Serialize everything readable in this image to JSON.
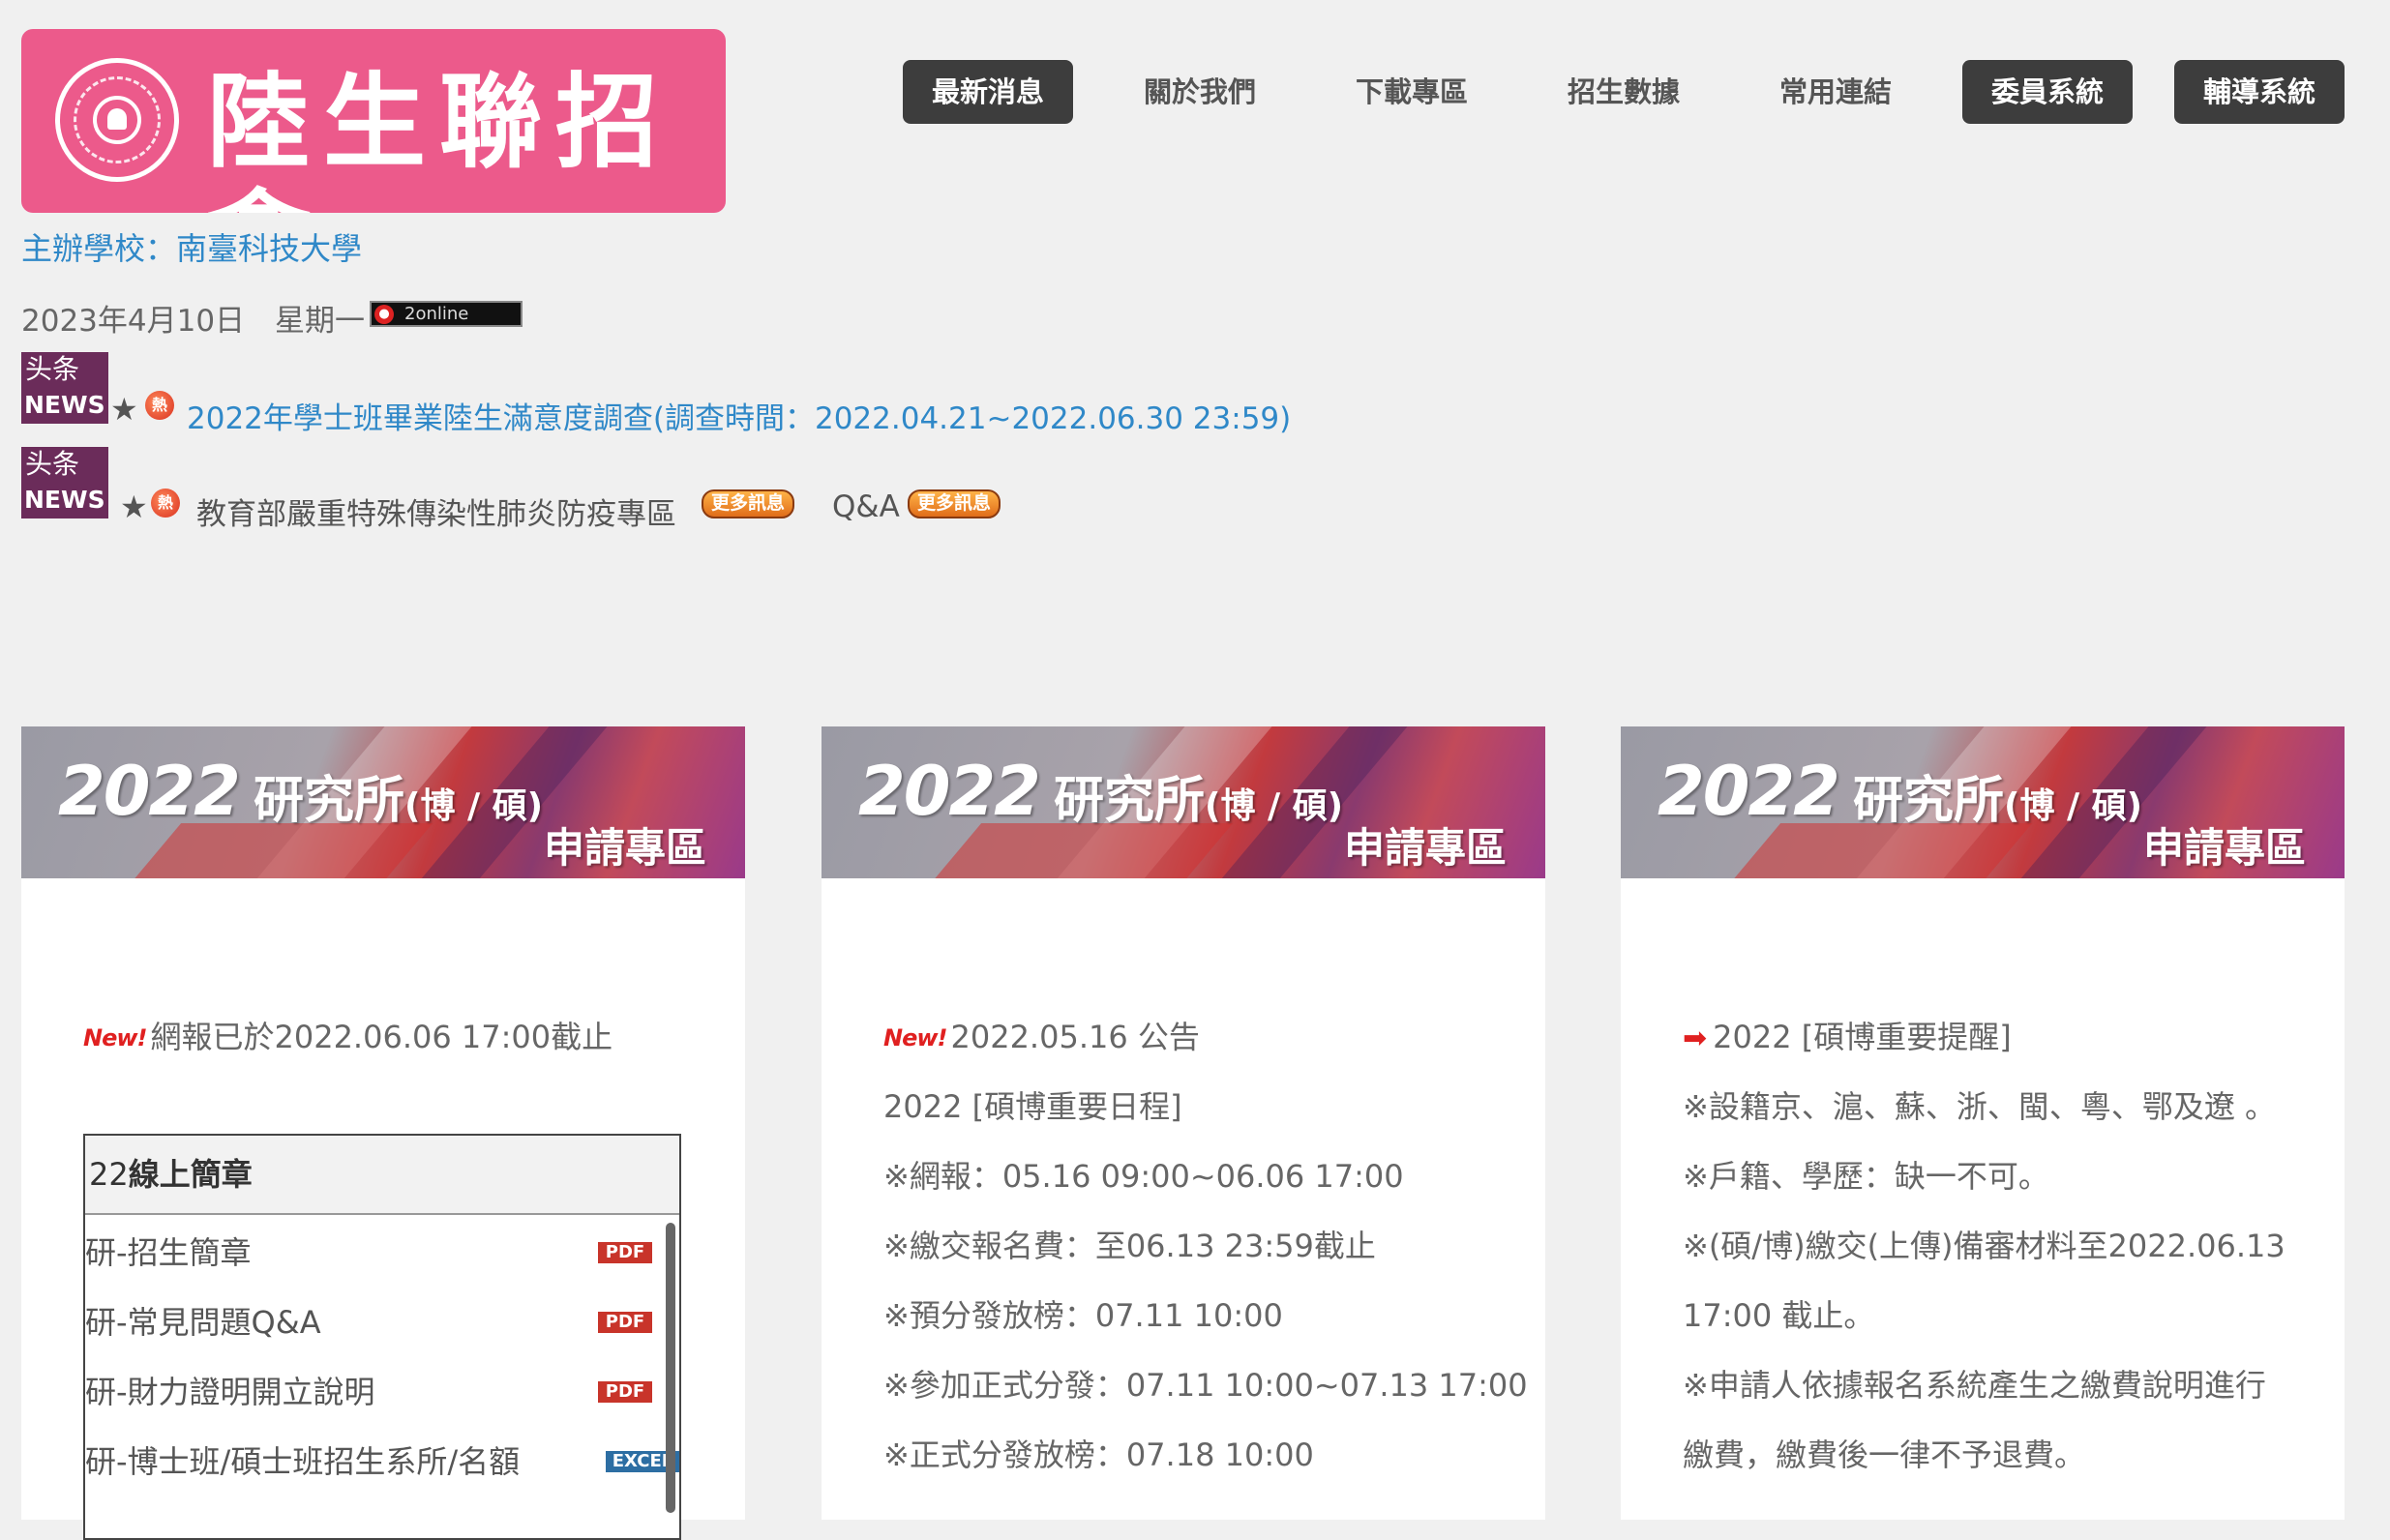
{
  "header": {
    "logo_text": "陸生聯招會",
    "host_school": "主辦學校：南臺科技大學",
    "date_text": "2023年4月10日　星期一",
    "online_text": "2online"
  },
  "nav": [
    {
      "label": "最新消息",
      "style": "dark"
    },
    {
      "label": "關於我們",
      "style": "plain"
    },
    {
      "label": "下載專區",
      "style": "plain"
    },
    {
      "label": "招生數據",
      "style": "plain"
    },
    {
      "label": "常用連結",
      "style": "plain"
    },
    {
      "label": "委員系統",
      "style": "dark"
    },
    {
      "label": "輔導系統",
      "style": "dark"
    }
  ],
  "news": {
    "badge_cn": "头条",
    "badge_en": "NEWS",
    "star": "★",
    "hot_glyph": "熱",
    "item1": "2022年學士班畢業陸生滿意度調查(調查時間：2022.04.21~2022.06.30 23:59)",
    "item2": "教育部嚴重特殊傳染性肺炎防疫專區",
    "qa": "Q&A",
    "more_label": "更多訊息"
  },
  "banner": {
    "year": "2022",
    "title": "研究所",
    "degree": "(博 / 碩)",
    "subtitle": "申請專區"
  },
  "card1": {
    "new_label": "New!",
    "notice": "網報已於2022.06.06 17:00截止",
    "box_title_prefix": "22",
    "box_title": "線上簡章",
    "rows": [
      {
        "label": "研-招生簡章",
        "type": "PDF"
      },
      {
        "label": "研-常見問題Q&A",
        "type": "PDF"
      },
      {
        "label": "研-財力證明開立說明",
        "type": "PDF"
      },
      {
        "label": "研-博士班/碩士班招生系所/名額",
        "type": "EXCEL"
      }
    ]
  },
  "card2": {
    "new_label": "New!",
    "lines": [
      "2022.05.16 公告",
      "2022 [碩博重要日程]",
      "※網報：05.16 09:00~06.06 17:00",
      "※繳交報名費：至06.13 23:59截止",
      "※預分發放榜：07.11 10:00",
      "※參加正式分發：07.11 10:00~07.13 17:00",
      "※正式分發放榜：07.18 10:00"
    ]
  },
  "card3": {
    "lines": [
      "2022 [碩博重要提醒]",
      "※設籍京、滬、蘇、浙、閩、粵、鄂及遼 。",
      "※戶籍、學歷：缺一不可。",
      "※(碩/博)繳交(上傳)備審材料至2022.06.13",
      "17:00 截止。",
      "※申請人依據報名系統產生之繳費說明進行",
      "繳費，繳費後一律不予退費。"
    ]
  }
}
